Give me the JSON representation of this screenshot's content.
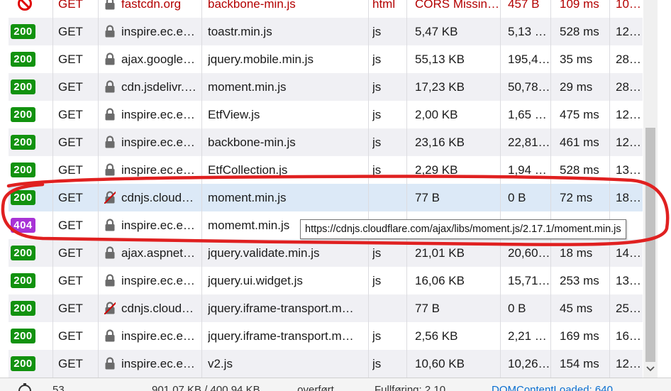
{
  "colors": {
    "status_ok": "#12920f",
    "status_not_found": "#a833d6",
    "blocked_text": "#b30000",
    "selected_row": "#dce9f7",
    "annotation_stroke": "#e02020"
  },
  "rows": [
    {
      "status": "",
      "method": "GET",
      "domain": "fastcdn.org",
      "file": "backbone-min.js",
      "type": "html",
      "transferred": "CORS Missin…",
      "size": "457 B",
      "duration": "109 ms",
      "waterfall": "10…",
      "icon": "blocked-icon",
      "secure": "lock-icon"
    },
    {
      "status": "200",
      "method": "GET",
      "domain": "inspire.ec.e…",
      "file": "toastr.min.js",
      "type": "js",
      "transferred": "5,47 KB",
      "size": "5,13 …",
      "duration": "528 ms",
      "waterfall": "12…",
      "secure": "lock-icon"
    },
    {
      "status": "200",
      "method": "GET",
      "domain": "ajax.google…",
      "file": "jquery.mobile.min.js",
      "type": "js",
      "transferred": "55,13 KB",
      "size": "195,4…",
      "duration": "35 ms",
      "waterfall": "28…",
      "secure": "lock-icon"
    },
    {
      "status": "200",
      "method": "GET",
      "domain": "cdn.jsdelivr.…",
      "file": "moment.min.js",
      "type": "js",
      "transferred": "17,23 KB",
      "size": "50,78…",
      "duration": "29 ms",
      "waterfall": "28…",
      "secure": "lock-icon"
    },
    {
      "status": "200",
      "method": "GET",
      "domain": "inspire.ec.e…",
      "file": "EtfView.js",
      "type": "js",
      "transferred": "2,00 KB",
      "size": "1,65 …",
      "duration": "475 ms",
      "waterfall": "12…",
      "secure": "lock-icon"
    },
    {
      "status": "200",
      "method": "GET",
      "domain": "inspire.ec.e…",
      "file": "backbone-min.js",
      "type": "js",
      "transferred": "23,16 KB",
      "size": "22,81…",
      "duration": "461 ms",
      "waterfall": "12…",
      "secure": "lock-icon"
    },
    {
      "status": "200",
      "method": "GET",
      "domain": "inspire.ec.e…",
      "file": "EtfCollection.js",
      "type": "js",
      "transferred": "2,29 KB",
      "size": "1,94 …",
      "duration": "528 ms",
      "waterfall": "13…",
      "secure": "lock-icon"
    },
    {
      "status": "200",
      "method": "GET",
      "domain": "cdnjs.cloud…",
      "file": "moment.min.js",
      "type": "",
      "transferred": "77 B",
      "size": "0 B",
      "duration": "72 ms",
      "waterfall": "18…",
      "secure": "insecure-lock-icon"
    },
    {
      "status": "404",
      "method": "GET",
      "domain": "inspire.ec.e…",
      "file": "momemt.min.js",
      "type": "",
      "transferred": "",
      "size": "",
      "duration": "",
      "waterfall": "",
      "secure": "lock-icon"
    },
    {
      "status": "200",
      "method": "GET",
      "domain": "ajax.aspnet…",
      "file": "jquery.validate.min.js",
      "type": "js",
      "transferred": "21,01 KB",
      "size": "20,60…",
      "duration": "18 ms",
      "waterfall": "14…",
      "secure": "lock-icon"
    },
    {
      "status": "200",
      "method": "GET",
      "domain": "inspire.ec.e…",
      "file": "jquery.ui.widget.js",
      "type": "js",
      "transferred": "16,06 KB",
      "size": "15,71…",
      "duration": "253 ms",
      "waterfall": "13…",
      "secure": "lock-icon"
    },
    {
      "status": "200",
      "method": "GET",
      "domain": "cdnjs.cloud…",
      "file": "jquery.iframe-transport.m…",
      "type": "",
      "transferred": "77 B",
      "size": "0 B",
      "duration": "45 ms",
      "waterfall": "25…",
      "secure": "insecure-lock-icon"
    },
    {
      "status": "200",
      "method": "GET",
      "domain": "inspire.ec.e…",
      "file": "jquery.iframe-transport.m…",
      "type": "js",
      "transferred": "2,56 KB",
      "size": "2,21 …",
      "duration": "169 ms",
      "waterfall": "16…",
      "secure": "lock-icon"
    },
    {
      "status": "200",
      "method": "GET",
      "domain": "inspire.ec.e…",
      "file": "v2.js",
      "type": "js",
      "transferred": "10,60 KB",
      "size": "10,26…",
      "duration": "154 ms",
      "waterfall": "12…",
      "secure": "lock-icon"
    }
  ],
  "tooltip": {
    "text": "https://cdnjs.cloudflare.com/ajax/libs/moment.js/2.17.1/moment.min.js"
  },
  "statusbar": {
    "requests": "53",
    "transferred": "901,07 KB / 400,94 KB",
    "loaded": "… overført",
    "finish": "Fullføring: 2,10 …",
    "domcontentloaded": "DOMContentLoaded: 640 …"
  }
}
